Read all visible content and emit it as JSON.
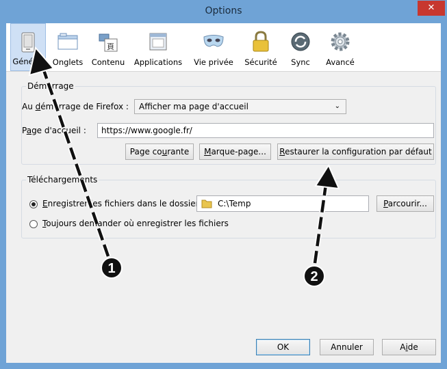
{
  "window": {
    "title": "Options",
    "close_glyph": "✕"
  },
  "toolbar": {
    "items": [
      {
        "label": "Général",
        "icon": "general-icon",
        "selected": true
      },
      {
        "label": "Onglets",
        "icon": "tabs-icon",
        "selected": false
      },
      {
        "label": "Contenu",
        "icon": "content-icon",
        "selected": false
      },
      {
        "label": "Applications",
        "icon": "applications-icon",
        "selected": false
      },
      {
        "label": "Vie privée",
        "icon": "mask-icon",
        "selected": false
      },
      {
        "label": "Sécurité",
        "icon": "lock-icon",
        "selected": false
      },
      {
        "label": "Sync",
        "icon": "sync-icon",
        "selected": false
      },
      {
        "label": "Avancé",
        "icon": "gear-icon",
        "selected": false
      }
    ]
  },
  "startup": {
    "legend": "Démarrage",
    "when_label_pre": "Au ",
    "when_label_key": "d",
    "when_label_post": "émarrage de Firefox :",
    "when_value": "Afficher ma page d'accueil",
    "home_label_pre": "P",
    "home_label_key": "a",
    "home_label_post": "ge d'accueil :",
    "home_value": "https://www.google.fr/",
    "btn_current_pre": "Page co",
    "btn_current_key": "u",
    "btn_current_post": "rante",
    "btn_bookmark_key": "M",
    "btn_bookmark_post": "arque-page...",
    "btn_restore_key": "R",
    "btn_restore_post": "estaurer la configuration par défaut"
  },
  "downloads": {
    "legend": "Téléchargements",
    "save_pre": "E",
    "save_key": "n",
    "save_post": "registrer les fichiers dans le dossier",
    "folder": "C:\\Temp",
    "browse_key": "P",
    "browse_post": "arcourir...",
    "ask_key": "T",
    "ask_post": "oujours demander où enregistrer les fichiers",
    "save_selected": true
  },
  "footer": {
    "ok": "OK",
    "cancel": "Annuler",
    "help_pre": "A",
    "help_key": "i",
    "help_post": "de"
  },
  "annotations": {
    "marker1": "1",
    "marker2": "2"
  }
}
